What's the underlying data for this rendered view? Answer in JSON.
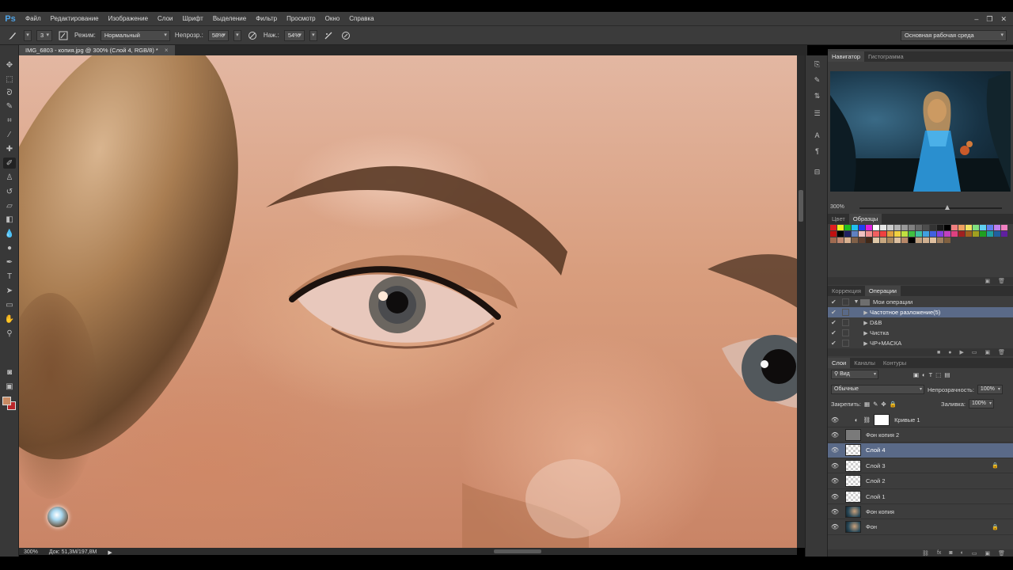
{
  "app": {
    "logo": "Ps"
  },
  "menu": [
    "Файл",
    "Редактирование",
    "Изображение",
    "Слои",
    "Шрифт",
    "Выделение",
    "Фильтр",
    "Просмотр",
    "Окно",
    "Справка"
  ],
  "window_controls": [
    "–",
    "❐",
    "✕"
  ],
  "options": {
    "brush_size": "3",
    "mode_label": "Режим:",
    "mode_value": "Нормальный",
    "opacity_label": "Непрозр.:",
    "opacity_value": "58%",
    "pressure_label": "Наж.:",
    "pressure_value": "54%",
    "workspace": "Основная рабочая среда"
  },
  "document": {
    "tab_title": "IMG_6803 - копия.jpg @ 300% (Слой 4, RGB/8) *",
    "close": "×"
  },
  "status": {
    "zoom": "300%",
    "doc_size": "Док: 51,3M/197,8M"
  },
  "colors": {
    "foreground": "#c78a63",
    "background": "#b9262a"
  },
  "panels": {
    "navigator_tabs": [
      "Навигатор",
      "Гистограмма"
    ],
    "navigator_zoom": "300%",
    "color_tabs": [
      "Цвет",
      "Образцы"
    ],
    "swatches": [
      "#e02020",
      "#f0f020",
      "#20c020",
      "#20c0f0",
      "#2040f0",
      "#e020e0",
      "#ffffff",
      "#e6e6e6",
      "#cccccc",
      "#b3b3b3",
      "#999999",
      "#808080",
      "#666666",
      "#4d4d4d",
      "#333333",
      "#1a1a1a",
      "#000000",
      "#f08080",
      "#f0a060",
      "#f0e060",
      "#80e080",
      "#60d0f0",
      "#6080f0",
      "#c080f0",
      "#f080c0",
      "#c01010",
      "#000000",
      "#202060",
      "#6080c0",
      "#f0c0c0",
      "#f09090",
      "#f06060",
      "#f04040",
      "#e0a040",
      "#f0d040",
      "#c0e040",
      "#40c040",
      "#40c0a0",
      "#40a0e0",
      "#4060e0",
      "#8040e0",
      "#c040c0",
      "#e04080",
      "#a02020",
      "#a06020",
      "#a0a020",
      "#20a020",
      "#20a0a0",
      "#2060a0",
      "#6020a0",
      "#a06a50",
      "#c08870",
      "#d8b090",
      "#806048",
      "#604030",
      "#402818",
      "#e0c8a8",
      "#c8a880",
      "#a88860",
      "#ddc0a0",
      "#b88868",
      "#000000",
      "#c0a080",
      "#d0b090",
      "#e0c0a0",
      "#a08060",
      "#806040"
    ],
    "actions_tabs": [
      "Коррекция",
      "Операции"
    ],
    "actions": [
      {
        "label": "Мои операции",
        "type": "set",
        "open": true
      },
      {
        "label": "Частотное разложение(5)",
        "type": "action",
        "selected": true
      },
      {
        "label": "D&B",
        "type": "action"
      },
      {
        "label": "Чистка",
        "type": "action"
      },
      {
        "label": "ЧР+МАСКА",
        "type": "action"
      }
    ],
    "layers_tabs": [
      "Слои",
      "Каналы",
      "Контуры"
    ],
    "layer_filter": "Вид",
    "blend_mode": "Обычные",
    "opacity_label": "Непрозрачность:",
    "opacity_value": "100%",
    "lock_label": "Закрепить:",
    "fill_label": "Заливка:",
    "fill_value": "100%",
    "layers": [
      {
        "name": "Кривые 1",
        "thumb": "adjust",
        "locked": false,
        "selected": false
      },
      {
        "name": "Фон копия 2",
        "thumb": "grey",
        "locked": false,
        "selected": false
      },
      {
        "name": "Слой 4",
        "thumb": "checker",
        "locked": false,
        "selected": true
      },
      {
        "name": "Слой 3",
        "thumb": "checker",
        "locked": true,
        "selected": false
      },
      {
        "name": "Слой 2",
        "thumb": "checker",
        "locked": false,
        "selected": false
      },
      {
        "name": "Слой 1",
        "thumb": "checker",
        "locked": false,
        "selected": false
      },
      {
        "name": "Фон копия",
        "thumb": "photo",
        "locked": false,
        "selected": false
      },
      {
        "name": "Фон",
        "thumb": "photo",
        "locked": true,
        "selected": false
      }
    ]
  }
}
